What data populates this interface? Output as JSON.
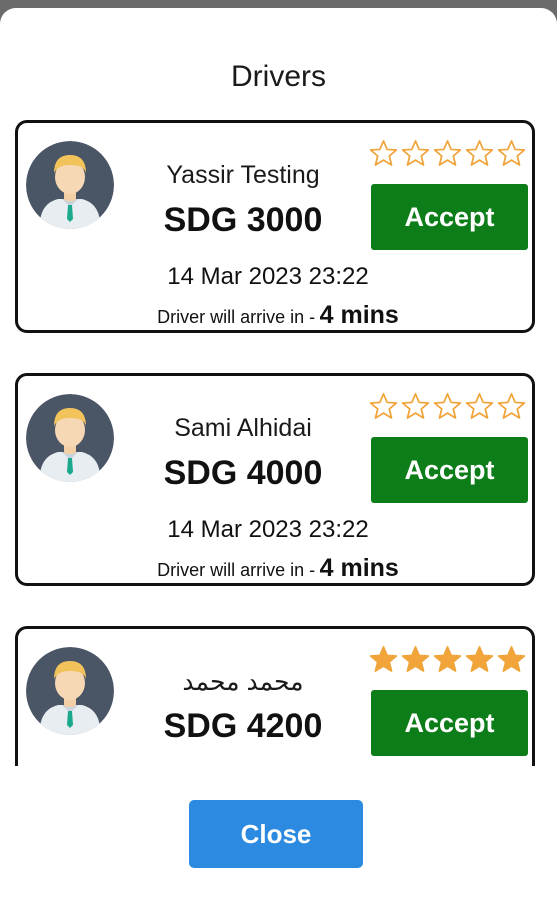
{
  "dialog": {
    "title": "Drivers",
    "close_label": "Close"
  },
  "drivers": [
    {
      "name": "Yassir Testing",
      "price": "SDG 3000",
      "datetime": "14 Mar 2023 23:22",
      "arrive_label": "Driver will arrive in -",
      "arrive_time": "4 mins",
      "rating": 0,
      "accept_label": "Accept"
    },
    {
      "name": "Sami Alhidai",
      "price": "SDG 4000",
      "datetime": "14 Mar 2023 23:22",
      "arrive_label": "Driver will arrive in -",
      "arrive_time": "4 mins",
      "rating": 0,
      "accept_label": "Accept"
    },
    {
      "name": "محمد محمد",
      "price": "SDG 4200",
      "datetime": "",
      "arrive_label": "",
      "arrive_time": "",
      "rating": 5,
      "accept_label": "Accept"
    }
  ],
  "colors": {
    "accept": "#0d7d1a",
    "close": "#2c8be0",
    "star": "#f0a43a"
  },
  "icons": {
    "avatar": "driver-avatar-icon",
    "star": "star-icon"
  }
}
